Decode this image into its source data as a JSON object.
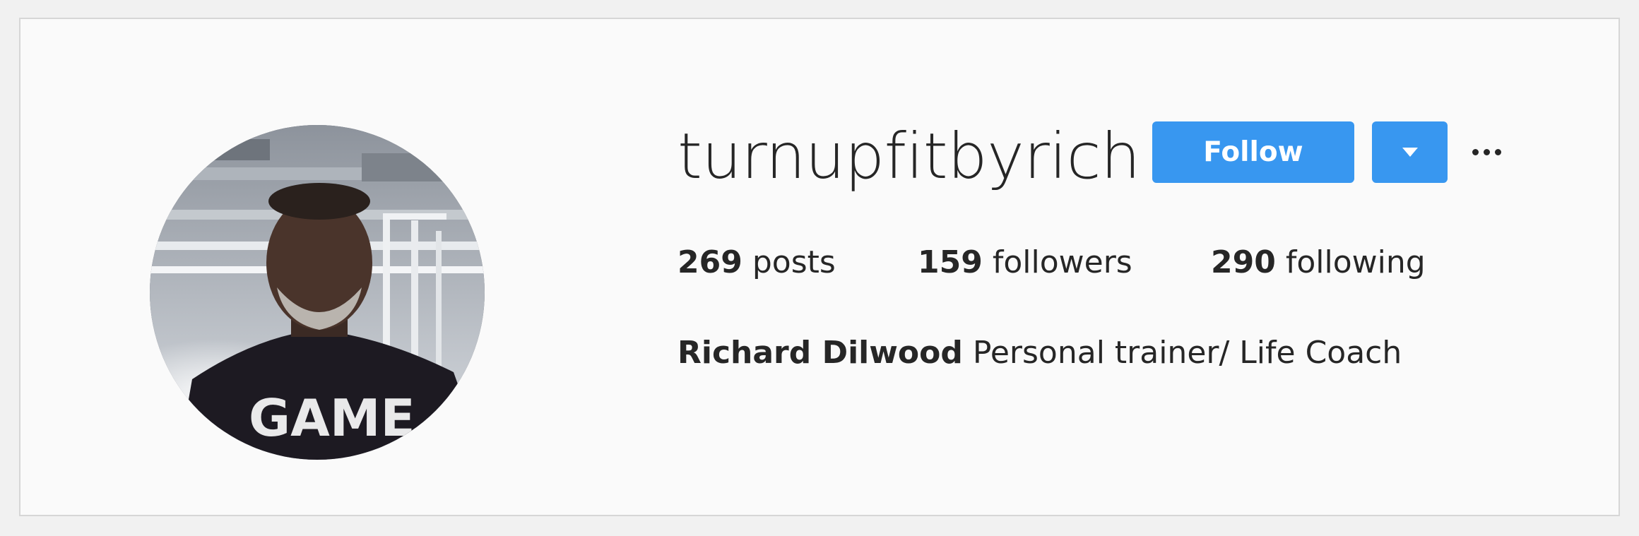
{
  "profile": {
    "username": "turnupfitbyrich",
    "avatar_icon": "profile-photo",
    "follow_label": "Follow",
    "dropdown_icon": "caret-down-icon",
    "more_icon": "more-options-icon",
    "stats": {
      "posts_count": "269",
      "posts_label": "posts",
      "followers_count": "159",
      "followers_label": "followers",
      "following_count": "290",
      "following_label": "following"
    },
    "full_name": "Richard Dilwood",
    "bio": "Personal trainer/ Life Coach"
  },
  "colors": {
    "accent": "#3897f0",
    "text": "#262626",
    "background": "#fafafa"
  }
}
